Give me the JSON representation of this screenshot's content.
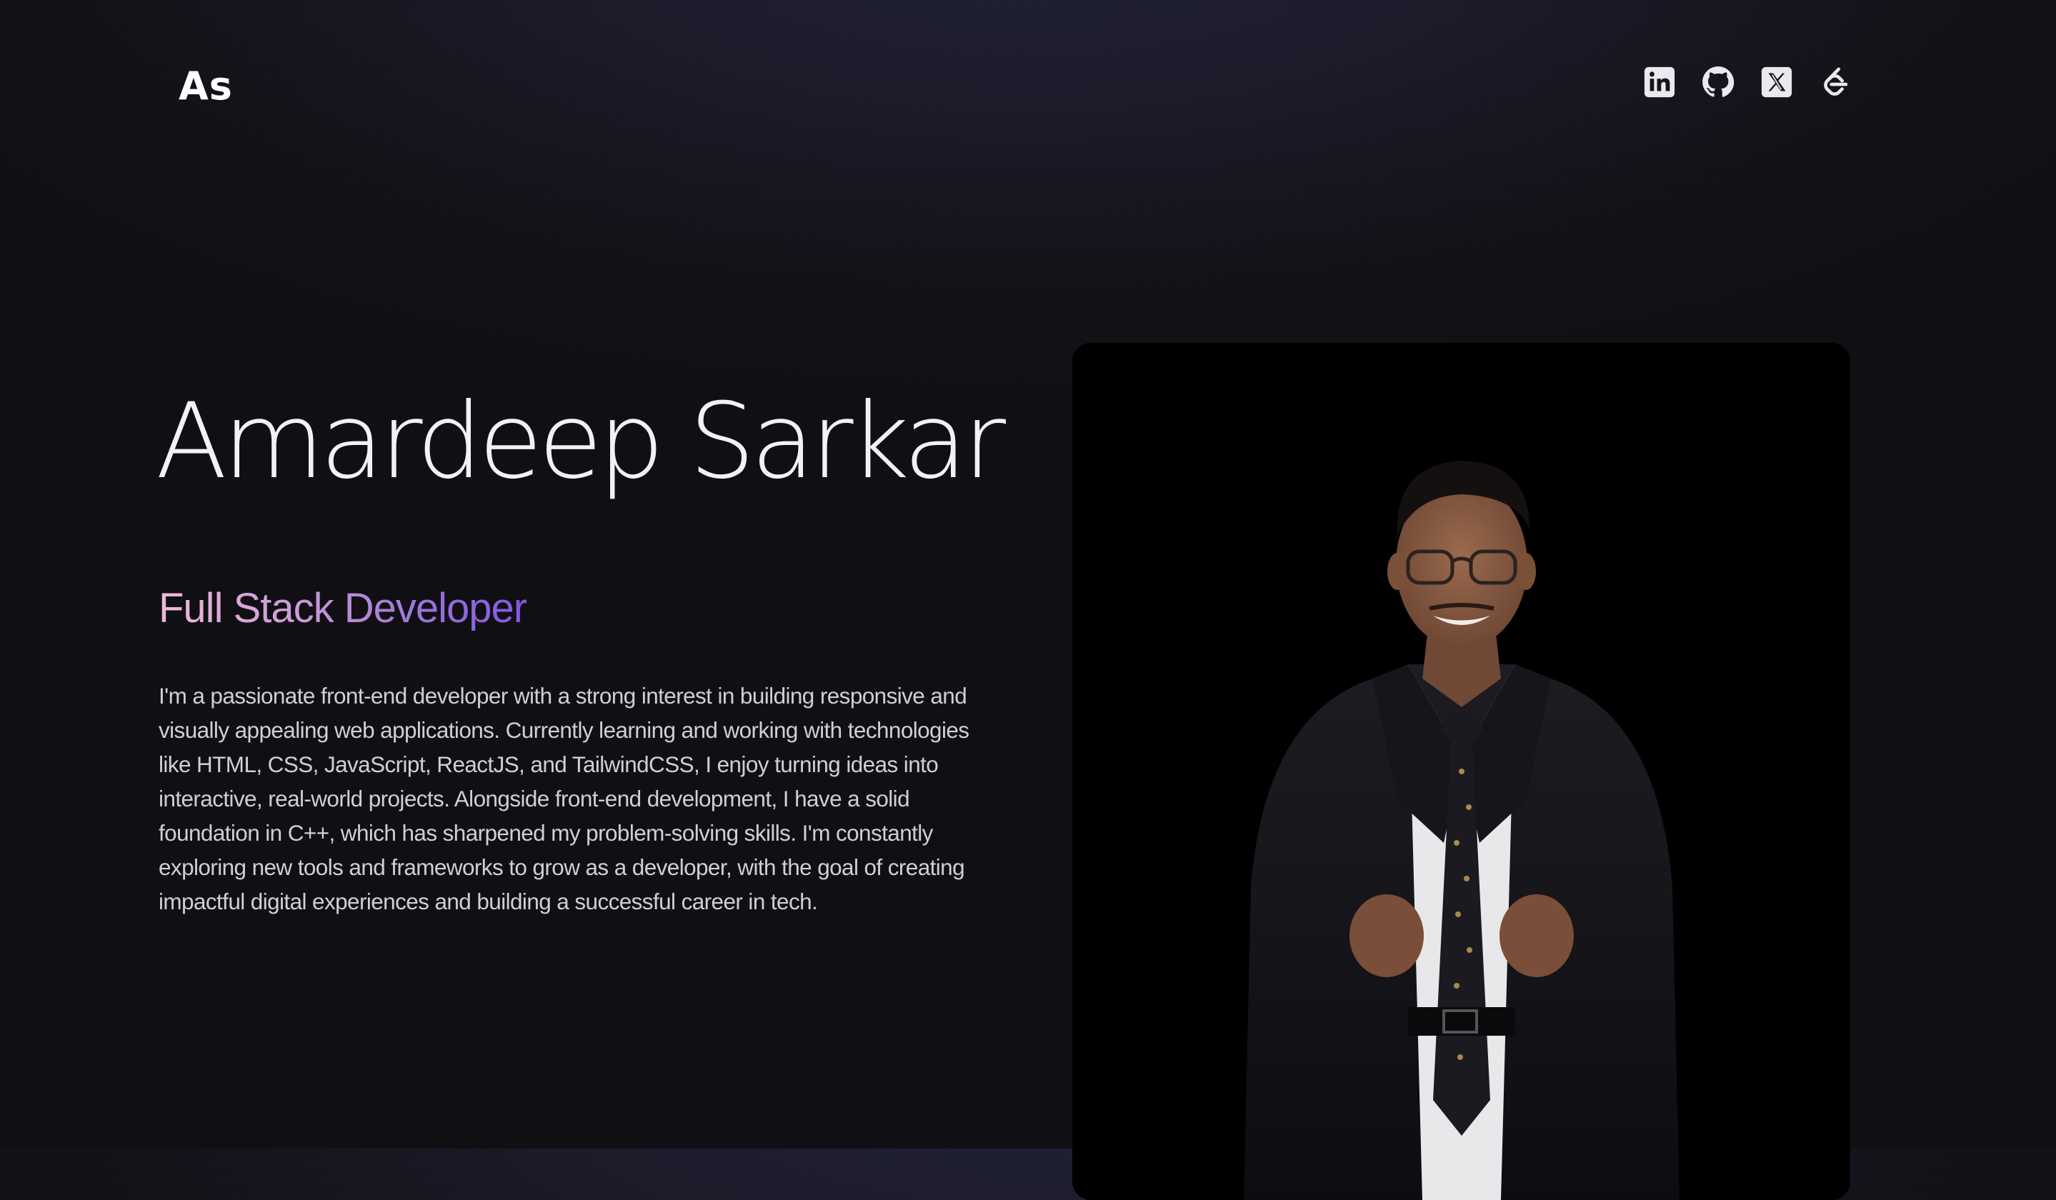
{
  "header": {
    "logo_text": "As",
    "social_links": [
      {
        "name": "LinkedIn",
        "icon": "linkedin-icon"
      },
      {
        "name": "GitHub",
        "icon": "github-icon"
      },
      {
        "name": "X",
        "icon": "x-icon"
      },
      {
        "name": "LeetCode",
        "icon": "leetcode-icon"
      }
    ]
  },
  "hero": {
    "name": "Amardeep Sarkar",
    "role": "Full Stack Developer",
    "bio": "I'm a passionate front-end developer with a strong interest in building responsive and visually appealing web applications. Currently learning and working with technologies like HTML, CSS, JavaScript, ReactJS, and TailwindCSS, I enjoy turning ideas into interactive, real-world projects. Alongside front-end development, I have a solid foundation in C++, which has sharpened my problem-solving skills. I'm constantly exploring new tools and frameworks to grow as a developer, with the goal of creating impactful digital experiences and building a successful career in tech."
  },
  "colors": {
    "background": "#14141c",
    "role_gradient_start": "#f0b8d8",
    "role_gradient_end": "#8456e4",
    "card_background": "#000000"
  }
}
